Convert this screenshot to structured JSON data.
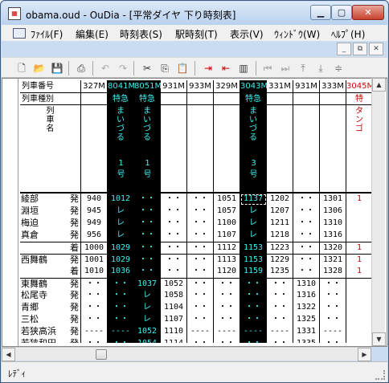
{
  "window": {
    "title": "obama.oud - OuDia - [平常ダイヤ 下り時刻表]"
  },
  "menu": [
    "ﾌｧｲﾙ(F)",
    "編集(E)",
    "時刻表(S)",
    "駅時刻(T)",
    "表示(V)",
    "ｳｨﾝﾄﾞｳ(W)",
    "ﾍﾙﾌﾟ(H)"
  ],
  "status": {
    "text": "ﾚﾃﾞｨ"
  },
  "header": {
    "train_no_label": "列車番号",
    "train_type_label": "列車種別",
    "train_name_label": "列\n車\n名"
  },
  "trains": [
    {
      "no": "327M",
      "type": "",
      "name": "",
      "num": "",
      "bg": "#ffffff"
    },
    {
      "no": "8041M",
      "type": "特急",
      "name": "まいづる",
      "num": "1号",
      "bg": "#000000"
    },
    {
      "no": "8051M",
      "type": "特急",
      "name": "まいづる",
      "num": "1号",
      "bg": "#000000"
    },
    {
      "no": "931M",
      "type": "",
      "name": "",
      "num": "",
      "bg": "#ffffff"
    },
    {
      "no": "933M",
      "type": "",
      "name": "",
      "num": "",
      "bg": "#ffffff"
    },
    {
      "no": "329M",
      "type": "",
      "name": "",
      "num": "",
      "bg": "#ffffff"
    },
    {
      "no": "3043M",
      "type": "特急",
      "name": "まいづる",
      "num": "3号",
      "bg": "#000000"
    },
    {
      "no": "331M",
      "type": "",
      "name": "",
      "num": "",
      "bg": "#ffffff"
    },
    {
      "no": "931M",
      "type": "",
      "name": "",
      "num": "",
      "bg": "#ffffff"
    },
    {
      "no": "333M",
      "type": "",
      "name": "",
      "num": "",
      "bg": "#ffffff"
    },
    {
      "no": "3045M",
      "type": "特",
      "name": "タンゴ",
      "num": "",
      "bg": "#ffffff"
    }
  ],
  "rows": [
    {
      "station": "綾部",
      "dir": "発",
      "cells": [
        "940",
        "1012",
        "・・",
        "・・",
        "・・",
        "1051",
        "1137",
        "1202",
        "・・",
        "1301",
        "1"
      ]
    },
    {
      "station": "淵垣",
      "dir": "発",
      "cells": [
        "945",
        "レ",
        "・・",
        "・・",
        "・・",
        "1057",
        "レ",
        "1207",
        "・・",
        "1306",
        ""
      ]
    },
    {
      "station": "梅迫",
      "dir": "発",
      "cells": [
        "949",
        "レ",
        "・・",
        "・・",
        "・・",
        "1100",
        "レ",
        "1211",
        "・・",
        "1310",
        ""
      ]
    },
    {
      "station": "真倉",
      "dir": "発",
      "cells": [
        "956",
        "レ",
        "・・",
        "・・",
        "・・",
        "1107",
        "レ",
        "1218",
        "・・",
        "1316",
        ""
      ]
    },
    {
      "station": "",
      "dir": "着",
      "cells": [
        "1000",
        "1029",
        "・・",
        "・・",
        "・・",
        "1112",
        "1153",
        "1223",
        "・・",
        "1320",
        "1"
      ]
    },
    {
      "station": "西舞鶴",
      "dir": "発",
      "cells": [
        "1001",
        "1029",
        "・・",
        "・・",
        "・・",
        "1113",
        "1153",
        "1229",
        "・・",
        "1321",
        "1"
      ]
    },
    {
      "station": "",
      "dir": "着",
      "cells": [
        "1010",
        "1036",
        "・・",
        "・・",
        "・・",
        "1120",
        "1159",
        "1235",
        "・・",
        "1328",
        "1"
      ]
    },
    {
      "station": "東舞鶴",
      "dir": "発",
      "cells": [
        "・・",
        "・・",
        "1037",
        "1052",
        "・・",
        "・・",
        "・・",
        "・・",
        "1310",
        "・・",
        ""
      ]
    },
    {
      "station": "松尾寺",
      "dir": "発",
      "cells": [
        "・・",
        "・・",
        "レ",
        "1058",
        "・・",
        "・・",
        "・・",
        "・・",
        "1316",
        "・・",
        ""
      ]
    },
    {
      "station": "青郷",
      "dir": "発",
      "cells": [
        "・・",
        "・・",
        "レ",
        "1104",
        "・・",
        "・・",
        "・・",
        "・・",
        "1322",
        "・・",
        ""
      ]
    },
    {
      "station": "三松",
      "dir": "発",
      "cells": [
        "・・",
        "・・",
        "レ",
        "1107",
        "・・",
        "・・",
        "・・",
        "・・",
        "1325",
        "・・",
        ""
      ]
    },
    {
      "station": "若狭高浜",
      "dir": "発",
      "cells": [
        "----",
        "----",
        "1052",
        "1110",
        "----",
        "----",
        "----",
        "----",
        "1331",
        "----",
        ""
      ]
    },
    {
      "station": "若狭和田",
      "dir": "発",
      "cells": [
        "・・",
        "・・",
        "1054",
        "1114",
        "・・",
        "・・",
        "・・",
        "・・",
        "1335",
        "・・",
        ""
      ]
    }
  ]
}
